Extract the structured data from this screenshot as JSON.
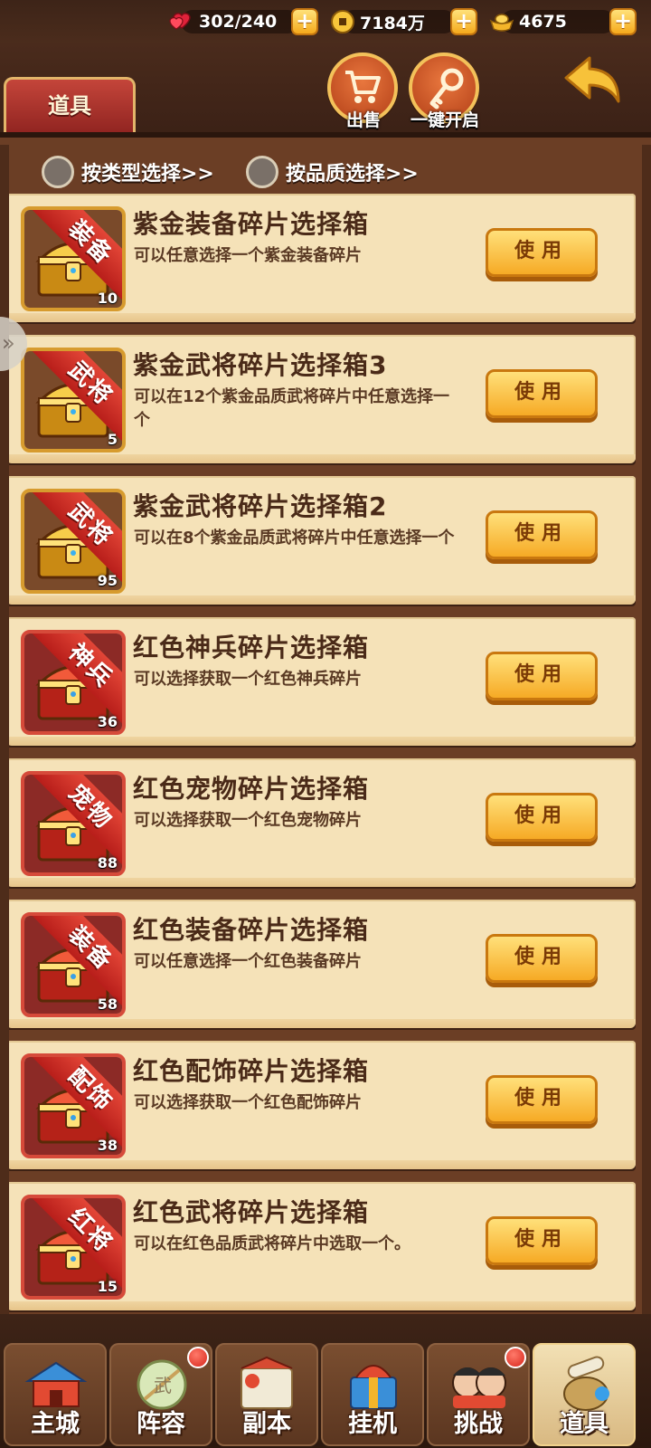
{
  "resources": [
    {
      "name": "stamina",
      "icon": "heart-icon",
      "value": "302/240"
    },
    {
      "name": "coins",
      "icon": "coin-icon",
      "value": "7184万"
    },
    {
      "name": "gold",
      "icon": "gold-ingot-icon",
      "value": "4675"
    }
  ],
  "plus_label": "+",
  "header": {
    "tab_label": "道具",
    "sell_label": "出售",
    "open_all_label": "一键开启"
  },
  "filters": {
    "by_type": "按类型选择>>",
    "by_quality": "按品质选择>>"
  },
  "side_tab_label": "»",
  "use_label": "使用",
  "items": [
    {
      "title": "紫金装备碎片选择箱",
      "desc": "可以任意选择一个紫金装备碎片",
      "tag": "装备",
      "count": "10",
      "quality": "gold",
      "icon": "gold-chest-icon"
    },
    {
      "title": "紫金武将碎片选择箱3",
      "desc": "可以在12个紫金品质武将碎片中任意选择一个",
      "tag": "武将",
      "count": "5",
      "quality": "gold",
      "icon": "gold-chest-icon"
    },
    {
      "title": "紫金武将碎片选择箱2",
      "desc": "可以在8个紫金品质武将碎片中任意选择一个",
      "tag": "武将",
      "count": "95",
      "quality": "gold",
      "icon": "gold-chest-icon"
    },
    {
      "title": "红色神兵碎片选择箱",
      "desc": "可以选择获取一个红色神兵碎片",
      "tag": "神兵",
      "count": "36",
      "quality": "red",
      "icon": "red-chest-icon"
    },
    {
      "title": "红色宠物碎片选择箱",
      "desc": "可以选择获取一个红色宠物碎片",
      "tag": "宠物",
      "count": "88",
      "quality": "red",
      "icon": "red-chest-icon"
    },
    {
      "title": "红色装备碎片选择箱",
      "desc": "可以任意选择一个红色装备碎片",
      "tag": "装备",
      "count": "58",
      "quality": "red",
      "icon": "red-chest-icon"
    },
    {
      "title": "红色配饰碎片选择箱",
      "desc": "可以选择获取一个红色配饰碎片",
      "tag": "配饰",
      "count": "38",
      "quality": "red",
      "icon": "red-chest-icon"
    },
    {
      "title": "红色武将碎片选择箱",
      "desc": "可以在红色品质武将碎片中选取一个。",
      "tag": "红将",
      "count": "15",
      "quality": "red",
      "icon": "red-chest-icon"
    }
  ],
  "nav": [
    {
      "label": "主城",
      "icon": "city-gate-icon",
      "active": false,
      "badge": false
    },
    {
      "label": "阵容",
      "icon": "formation-icon",
      "active": false,
      "badge": true
    },
    {
      "label": "副本",
      "icon": "dungeon-icon",
      "active": false,
      "badge": false
    },
    {
      "label": "挂机",
      "icon": "idle-gift-icon",
      "active": false,
      "badge": false
    },
    {
      "label": "挑战",
      "icon": "challenge-icon",
      "active": false,
      "badge": true
    },
    {
      "label": "道具",
      "icon": "scroll-bag-icon",
      "active": true,
      "badge": false
    }
  ],
  "colors": {
    "gold_frame": "#d79b2e",
    "red_frame": "#d64a3a",
    "button": "#f6aa25",
    "card": "#f5e2b8",
    "background": "#5a3422"
  }
}
